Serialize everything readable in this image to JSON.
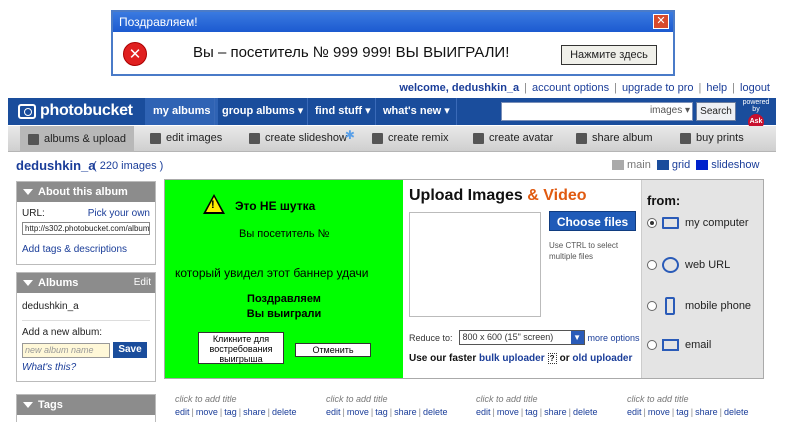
{
  "popup": {
    "title": "Поздравляем!",
    "close": "✕",
    "message": "Вы – посетитель № 999 999! ВЫ ВЫИГРАЛИ!",
    "button": "Нажмите здесь"
  },
  "toplinks": {
    "welcome": "welcome, dedushkin_a",
    "account": "account options",
    "upgrade": "upgrade to pro",
    "help": "help",
    "logout": "logout"
  },
  "nav": {
    "logo": "photobucket",
    "tabs": [
      "my albums",
      "group albums ▾",
      "find stuff ▾",
      "what's new ▾"
    ],
    "search_filter": "images ▾",
    "search_button": "Search",
    "powered_by": "powered by",
    "ask": "Ask"
  },
  "toolbar": {
    "items": [
      "albums & upload",
      "edit images",
      "create slideshow",
      "create remix",
      "create avatar",
      "share album",
      "buy prints"
    ]
  },
  "album": {
    "user": "dedushkin_a",
    "count": "( 220 images )",
    "view_main": "main",
    "view_grid": "grid",
    "view_slideshow": "slideshow"
  },
  "sidebar": {
    "about_title": "About this album",
    "url_label": "URL:",
    "pick_own": "Pick your own",
    "url_value": "http://s302.photobucket.com/album",
    "add_tags": "Add tags & descriptions",
    "albums_title": "Albums",
    "albums_edit": "Edit",
    "album_item": "dedushkin_a",
    "new_album_label": "Add a new album:",
    "new_album_placeholder": "new album name",
    "save": "Save",
    "whats_this": "What's this?",
    "tags_title": "Tags"
  },
  "banner": {
    "title": "Это НЕ шутка",
    "line1": "Вы посетитель №",
    "line2": "который увидел этот баннер удачи",
    "line3a": "Поздравляем",
    "line3b": "Вы выиграли",
    "btn_claim": "Кликните для востребования выигрыша",
    "btn_cancel": "Отменить"
  },
  "upload": {
    "title": "Upload Images",
    "amp": " & ",
    "video": "Video",
    "choose": "Choose files",
    "hint": "Use CTRL to select multiple files",
    "reduce_label": "Reduce to:",
    "reduce_value": "800 x 600 (15\" screen)",
    "more_options": "more options",
    "faster_prefix": "Use our faster",
    "bulk": "bulk uploader",
    "or": "or",
    "old": "old uploader",
    "from_title": "from:",
    "sources": [
      "my computer",
      "web URL",
      "mobile phone",
      "email"
    ]
  },
  "grid": {
    "title": "click to add title",
    "actions": [
      "edit",
      "move",
      "tag",
      "share",
      "delete"
    ]
  }
}
